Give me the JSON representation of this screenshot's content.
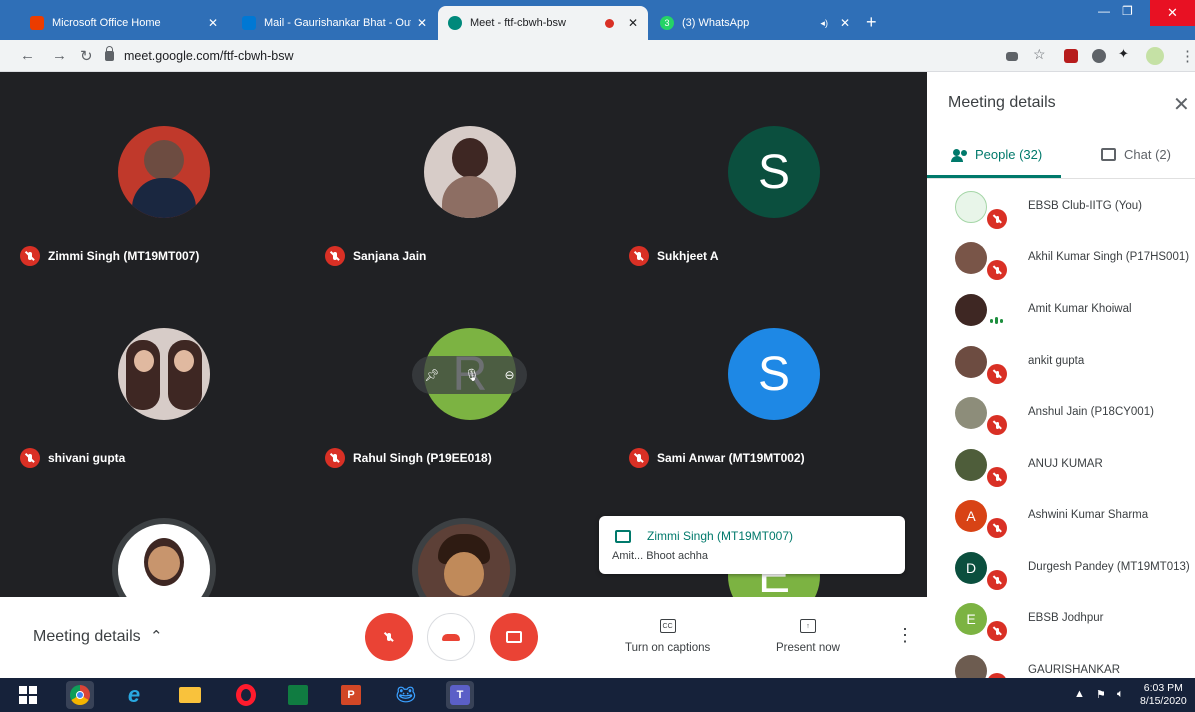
{
  "browser": {
    "tabs": [
      {
        "title": "Microsoft Office Home",
        "favicon_color": "#eb3c00"
      },
      {
        "title": "Mail - Gaurishankar Bhat - Outlo",
        "favicon_color": "#0078d4"
      },
      {
        "title": "Meet - ftf-cbwh-bsw",
        "favicon_color": "#00897b"
      },
      {
        "title": "(3) WhatsApp",
        "favicon_color": "#25d366"
      }
    ],
    "whatsapp_badge": "3",
    "url": "meet.google.com/ftf-cbwh-bsw"
  },
  "meeting": {
    "tiles": [
      {
        "name": "Zimmi Singh (MT19MT007)",
        "avatar_color": "#c0392b"
      },
      {
        "name": "Sanjana Jain",
        "avatar_color": "#8d6e63"
      },
      {
        "name": "Sukhjeet A",
        "avatar_letter": "S",
        "avatar_color": "#0b4f3e"
      },
      {
        "name": "shivani gupta",
        "avatar_color": "#d7ccc8"
      },
      {
        "name": "Rahul Singh (P19EE018)",
        "avatar_letter": "R",
        "avatar_color": "#7cb342"
      },
      {
        "name": "Sami Anwar (MT19MT002)",
        "avatar_letter": "S",
        "avatar_color": "#1e88e5"
      },
      {
        "name": "",
        "avatar_color": "#e0e0e0"
      },
      {
        "name": "",
        "avatar_color": "#5d4037"
      },
      {
        "name": "",
        "avatar_letter": "E",
        "avatar_color": "#7cb342"
      }
    ],
    "toast": {
      "sender": "Zimmi Singh (MT19MT007)",
      "message": "Amit... Bhoot achha"
    }
  },
  "controls": {
    "meeting_details": "Meeting details",
    "captions": "Turn on captions",
    "captions_icon": "CC",
    "present": "Present now"
  },
  "panel": {
    "title": "Meeting details",
    "people_tab": "People (32)",
    "chat_tab": "Chat (2)",
    "participants": [
      {
        "name": "EBSB Club-IITG (You)",
        "avatar_color": "#e8f5e9",
        "muted": true
      },
      {
        "name": "Akhil Kumar Singh (P17HS001)",
        "avatar_color": "#795548",
        "muted": true
      },
      {
        "name": "Amit Kumar Khoiwal",
        "avatar_color": "#3e2723",
        "muted": false
      },
      {
        "name": "ankit gupta",
        "avatar_color": "#6d4c41",
        "muted": true
      },
      {
        "name": "Anshul Jain (P18CY001)",
        "avatar_color": "#8d8d7a",
        "muted": true
      },
      {
        "name": "ANUJ KUMAR",
        "avatar_color": "#4e5d3a",
        "muted": true
      },
      {
        "name": "Ashwini Kumar Sharma",
        "avatar_letter": "A",
        "avatar_color": "#d84315",
        "muted": true
      },
      {
        "name": "Durgesh Pandey (MT19MT013)",
        "avatar_letter": "D",
        "avatar_color": "#0b4f3e",
        "muted": true
      },
      {
        "name": "EBSB Jodhpur",
        "avatar_letter": "E",
        "avatar_color": "#7cb342",
        "muted": true
      },
      {
        "name": "GAURISHANKAR",
        "avatar_color": "#6d5c50",
        "muted": true
      }
    ]
  },
  "taskbar": {
    "time": "6:03 PM",
    "date": "8/15/2020",
    "powerpoint_label": "P",
    "teams_label": "T"
  }
}
